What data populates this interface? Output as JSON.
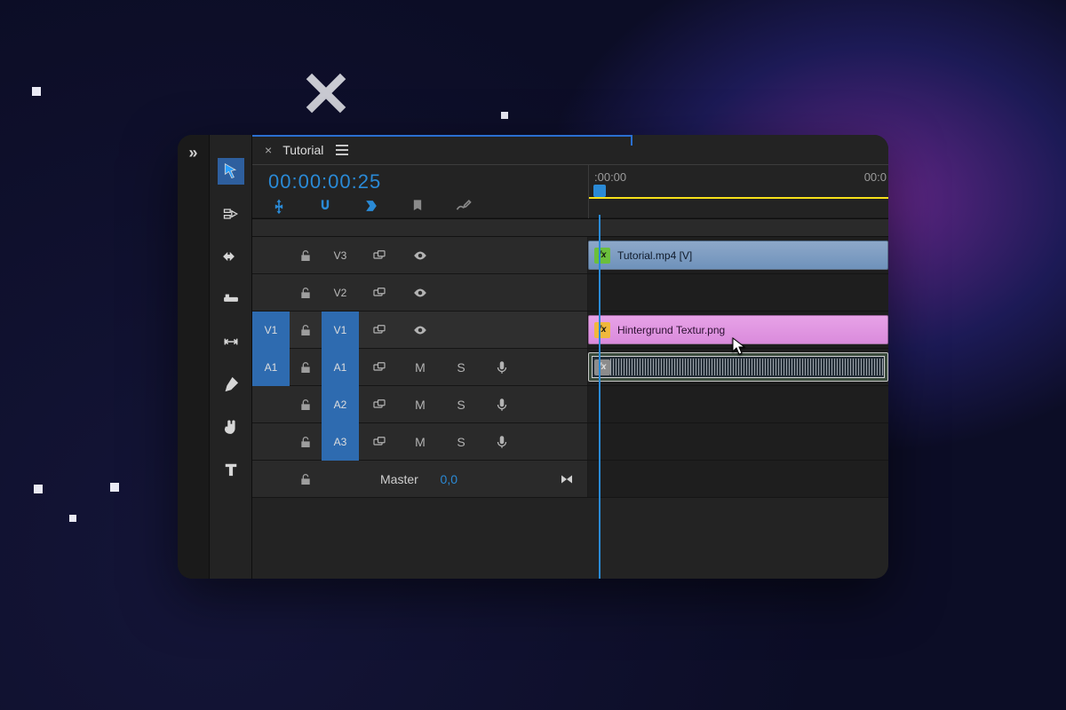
{
  "panel": {
    "tab_label": "Tutorial",
    "timecode": "00:00:00:25",
    "ruler_labels": {
      "start": ":00:00",
      "next": "00:0"
    }
  },
  "tools": {
    "selection": "Selection",
    "track_select": "Track Select",
    "ripple": "Ripple Edit",
    "razor": "Razor",
    "slip": "Slip",
    "pen": "Pen",
    "hand": "Hand",
    "type": "Type"
  },
  "tracks": {
    "v3": {
      "label": "V3",
      "clip": "Tutorial.mp4 [V]"
    },
    "v2": {
      "label": "V2"
    },
    "v1": {
      "label": "V1",
      "src": "V1",
      "clip": "Hintergrund Textur.png"
    },
    "a1": {
      "label": "A1",
      "src": "A1",
      "mute": "M",
      "solo": "S"
    },
    "a2": {
      "label": "A2",
      "mute": "M",
      "solo": "S"
    },
    "a3": {
      "label": "A3",
      "mute": "M",
      "solo": "S"
    },
    "master": {
      "label": "Master",
      "value": "0,0"
    }
  }
}
